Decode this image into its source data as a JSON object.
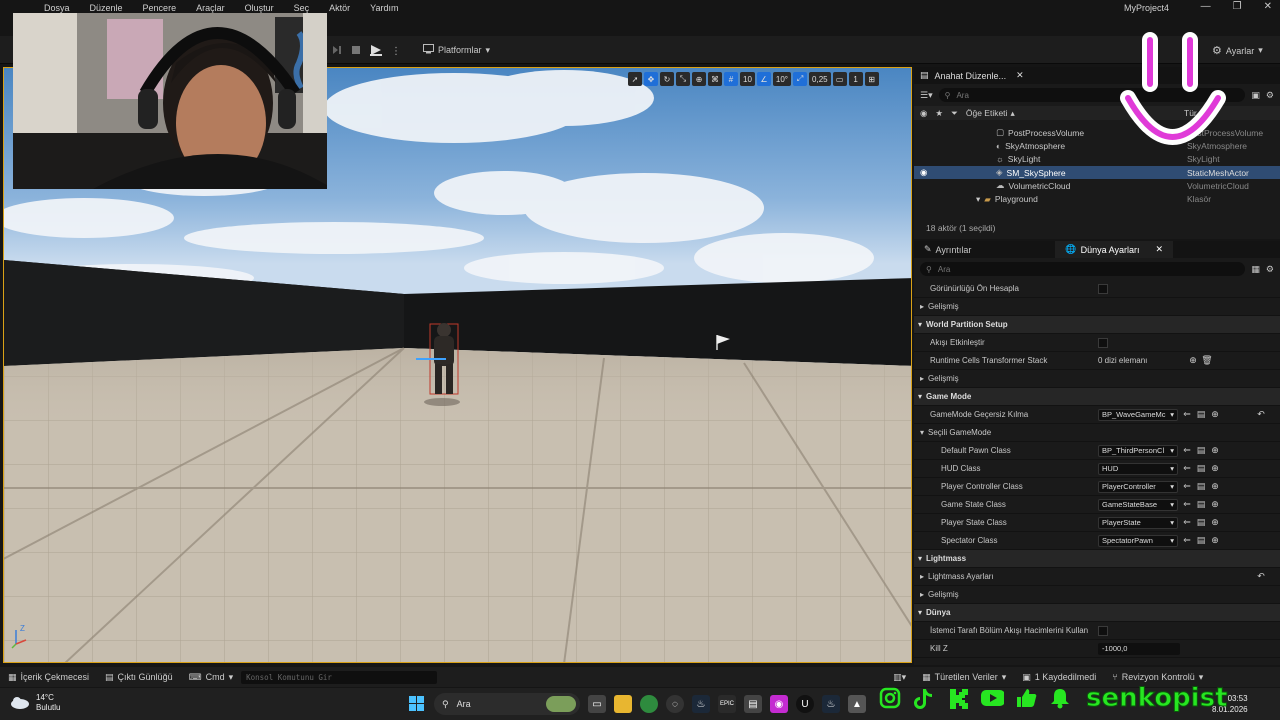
{
  "menu": [
    "Dosya",
    "Düzenle",
    "Pencere",
    "Araçlar",
    "Oluştur",
    "Seç",
    "Aktör",
    "Yardım"
  ],
  "window": {
    "project": "MyProject4"
  },
  "toolbar": {
    "platforms": "Platformlar",
    "settings": "Ayarlar"
  },
  "viewport": {
    "grid_snap": "10",
    "rot_snap": "10°",
    "scale_snap": "0,25",
    "camera_speed": "1",
    "axis_z": "Z"
  },
  "outliner": {
    "tab": "Anahat Düzenle...",
    "search_placeholder": "Ara",
    "col_label": "Öğe Etiketi",
    "col_type": "Tür",
    "rows": [
      {
        "name": "PostProcessVolume",
        "type": "PostProcessVolume",
        "icon": "post-process-icon",
        "indent": 1
      },
      {
        "name": "SkyAtmosphere",
        "type": "SkyAtmosphere",
        "icon": "sky-atmosphere-icon",
        "indent": 1
      },
      {
        "name": "SkyLight",
        "type": "SkyLight",
        "icon": "skylight-icon",
        "indent": 1
      },
      {
        "name": "SM_SkySphere",
        "type": "StaticMeshActor",
        "icon": "static-mesh-icon",
        "indent": 1,
        "selected": true
      },
      {
        "name": "VolumetricCloud",
        "type": "VolumetricCloud",
        "icon": "cloud-icon",
        "indent": 1
      },
      {
        "name": "Playground",
        "type": "Klasör",
        "icon": "folder-icon",
        "indent": 0
      }
    ],
    "count": "18 aktör (1 seçildi)"
  },
  "details": {
    "tab_details": "Ayrıntılar",
    "tab_world": "Dünya Ayarları",
    "search_placeholder": "Ara",
    "rows": {
      "precompute": "Görünürlüğü Ön Hesapla",
      "advanced1": "Gelişmiş",
      "wp_section": "World Partition Setup",
      "enable_streaming": "Akışı Etkinleştir",
      "runtime_cells": "Runtime Cells Transformer Stack",
      "runtime_cells_val": "0 dizi elemanı",
      "advanced2": "Gelişmiş",
      "gamemode_section": "Game Mode",
      "gamemode_override": "GameMode Geçersiz Kılma",
      "gamemode_override_val": "BP_WaveGameMc",
      "selected_gamemode": "Seçili GameMode",
      "default_pawn": "Default Pawn Class",
      "default_pawn_val": "BP_ThirdPersonCl",
      "hud": "HUD Class",
      "hud_val": "HUD",
      "player_controller": "Player Controller Class",
      "player_controller_val": "PlayerController",
      "game_state": "Game State Class",
      "game_state_val": "GameStateBase",
      "player_state": "Player State Class",
      "player_state_val": "PlayerState",
      "spectator": "Spectator Class",
      "spectator_val": "SpectatorPawn",
      "lightmass_section": "Lightmass",
      "lightmass_settings": "Lightmass Ayarları",
      "advanced3": "Gelişmiş",
      "world_section": "Dünya",
      "client_streaming": "İstemci Tarafı Bölüm Akışı Hacimlerini Kullan",
      "kill_z": "Kill Z",
      "kill_z_val": "-1000,0"
    }
  },
  "bottombar": {
    "content_drawer": "İçerik Çekmecesi",
    "output_log": "Çıktı Günlüğü",
    "cmd": "Cmd",
    "console_placeholder": "Konsol Komutunu Gir",
    "derived": "Türetilen Veriler",
    "unsaved": "1 Kaydedilmedi",
    "revision": "Revizyon Kontrolü"
  },
  "taskbar": {
    "temp": "14°C",
    "weather": "Bulutlu",
    "search": "Ara",
    "time": "03:53",
    "date": "8.01.2026"
  },
  "overlay": {
    "handle": "senkopist"
  }
}
